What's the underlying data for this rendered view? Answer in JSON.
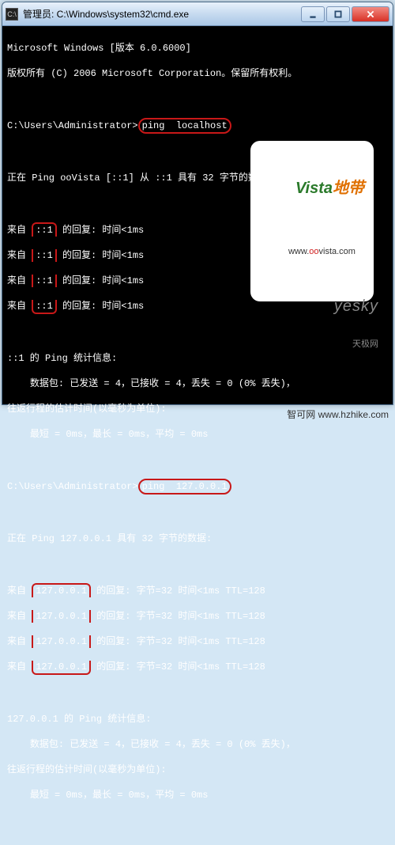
{
  "window": {
    "title": "管理员: C:\\Windows\\system32\\cmd.exe"
  },
  "terminal": {
    "header1": "Microsoft Windows [版本 6.0.6000]",
    "header2": "版权所有 (C) 2006 Microsoft Corporation。保留所有权利。",
    "prompt1_prefix": "C:\\Users\\Administrator>",
    "cmd1": "ping  localhost",
    "pinging1": "正在 Ping ooVista [::1] 从 ::1 具有 32 字节的数据:",
    "reply1_prefix": "来自 ",
    "reply1_ip": "::1",
    "reply1_suffix": " 的回复: 时间<1ms",
    "stats1_title": "::1 的 Ping 统计信息:",
    "stats1_packets": "    数据包: 已发送 = 4，已接收 = 4，丢失 = 0 (0% 丢失)，",
    "stats1_rtt": "往返行程的估计时间(以毫秒为单位):",
    "stats1_times": "    最短 = 0ms，最长 = 0ms，平均 = 0ms",
    "prompt2_prefix": "C:\\Users\\Administrator>",
    "cmd2": "ping  127.0.0.1",
    "pinging2": "正在 Ping 127.0.0.1 具有 32 字节的数据:",
    "reply2_prefix": "来自 ",
    "reply2_ip": "127.0.0.1",
    "reply2_suffix": " 的回复: 字节=32 时间<1ms TTL=128",
    "stats2_title": "127.0.0.1 的 Ping 统计信息:",
    "stats2_packets": "    数据包: 已发送 = 4，已接收 = 4，丢失 = 0 (0% 丢失)，",
    "stats2_rtt": "往返行程的估计时间(以毫秒为单位):",
    "stats2_times": "    最短 = 0ms，最长 = 0ms，平均 = 0ms"
  },
  "watermarks": {
    "vista_v": "Vista",
    "vista_zh": "地带",
    "vista_url_prefix": "www.",
    "vista_url_oo": "oo",
    "vista_url_rest": "vista.com",
    "yesky_brand": "yesky",
    "yesky_sub": "天极网",
    "credit": "智可网 www.hzhike.com"
  }
}
